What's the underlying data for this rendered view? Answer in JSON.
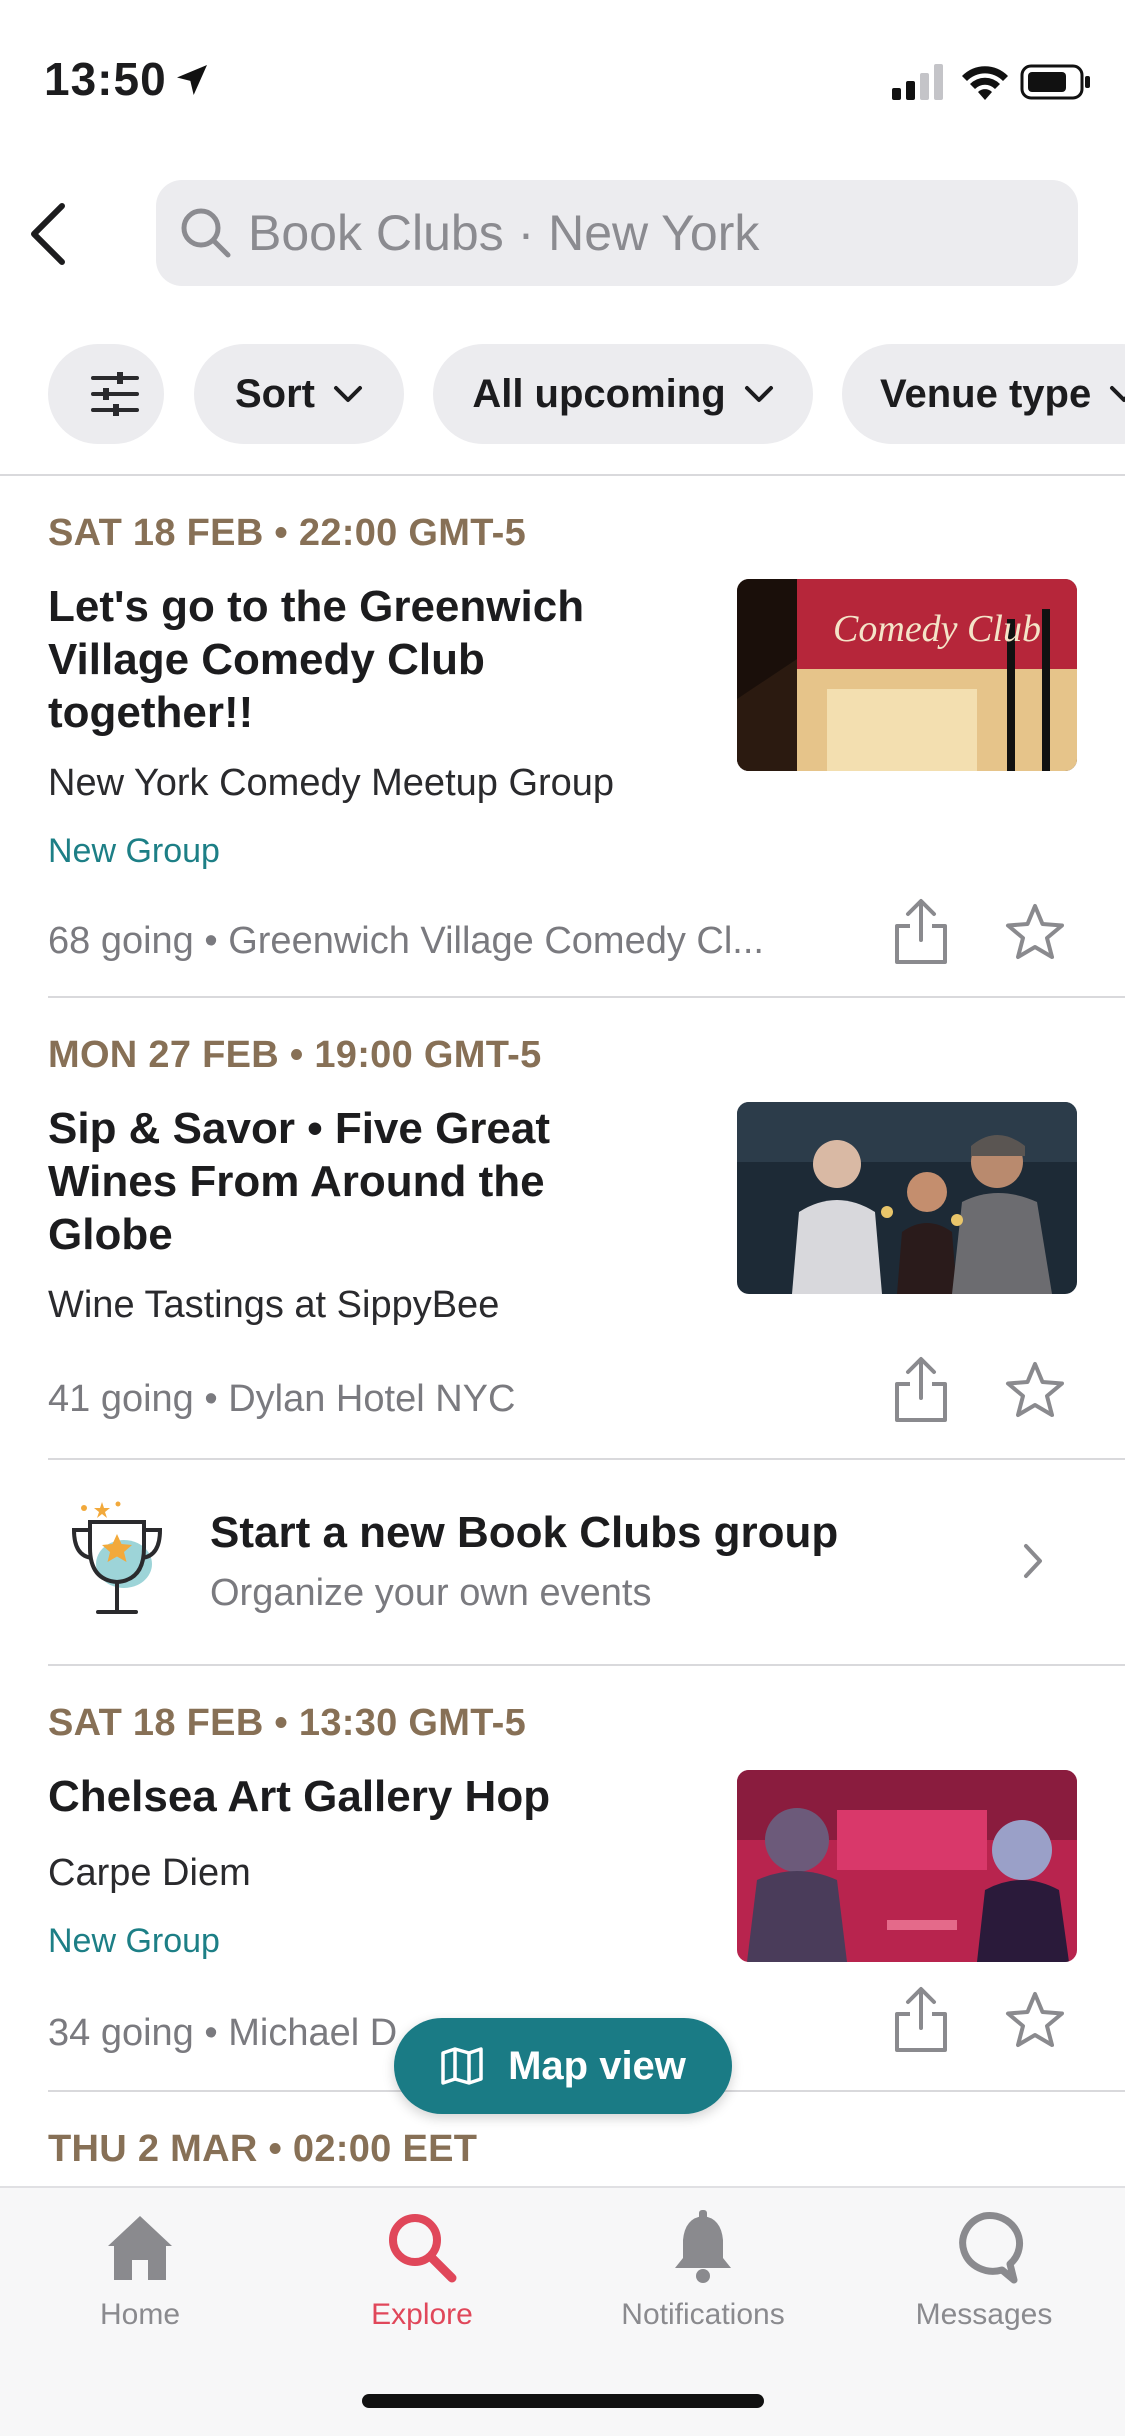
{
  "status_bar": {
    "time": "13:50"
  },
  "search": {
    "query": "Book Clubs · New York"
  },
  "filters": [
    {
      "label": "Sort"
    },
    {
      "label": "All upcoming"
    },
    {
      "label": "Venue type"
    }
  ],
  "events": [
    {
      "date": "SAT 18 FEB • 22:00 GMT-5",
      "title": "Let's go to the Greenwich Village Comedy Club together!!",
      "group": "New York Comedy Meetup Group",
      "badge": "New Group",
      "meta": "68 going • Greenwich Village Comedy Cl...",
      "image_text": "Comedy Club"
    },
    {
      "date": "MON 27 FEB • 19:00 GMT-5",
      "title": "Sip & Savor • Five Great Wines From Around the Globe",
      "group": "Wine Tastings at SippyBee",
      "badge": "",
      "meta": "41 going • Dylan Hotel NYC"
    },
    {
      "date": "SAT 18 FEB • 13:30 GMT-5",
      "title": "Chelsea Art Gallery Hop",
      "group": "Carpe Diem",
      "badge": "New Group",
      "meta": "34 going • Michael D"
    },
    {
      "date": "THU 2 MAR • 02:00 EET"
    }
  ],
  "promo": {
    "title": "Start a new Book Clubs group",
    "subtitle": "Organize your own events"
  },
  "map_button": {
    "label": "Map view"
  },
  "tabs": [
    {
      "label": "Home",
      "icon": "home-icon"
    },
    {
      "label": "Explore",
      "icon": "search-icon",
      "active": true
    },
    {
      "label": "Notifications",
      "icon": "bell-icon"
    },
    {
      "label": "Messages",
      "icon": "chat-bubble-icon"
    }
  ],
  "colors": {
    "accent_teal": "#1a7b85",
    "date_brown": "#877056",
    "badge_teal": "#1d7f86",
    "active_tab_red": "#e0475a"
  }
}
